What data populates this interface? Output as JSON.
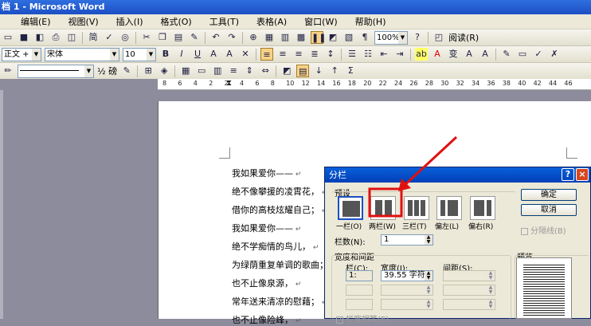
{
  "window": {
    "title": "档 1 - Microsoft Word"
  },
  "menu": [
    "编辑(E)",
    "视图(V)",
    "插入(I)",
    "格式(O)",
    "工具(T)",
    "表格(A)",
    "窗口(W)",
    "帮助(H)"
  ],
  "toolbar1": {
    "zoom": "100%",
    "reading": "阅读(R)"
  },
  "toolbar2": {
    "style": "正文 + Aria",
    "font": "宋体",
    "size": "10",
    "bold": "B",
    "italic": "I",
    "underline": "U",
    "char_a": "A"
  },
  "toolbar3": {
    "line_size": "½ 磅"
  },
  "ruler": {
    "ticks": [
      "8",
      "6",
      "4",
      "2",
      "2",
      "4",
      "6",
      "8",
      "10",
      "12",
      "14",
      "16",
      "18",
      "20",
      "22",
      "24",
      "26",
      "28",
      "30",
      "32",
      "34",
      "36",
      "38",
      "40",
      "42",
      "44",
      "46"
    ]
  },
  "document": {
    "lines": [
      "我如果爱你——",
      "绝不像攀援的凌霄花，",
      "借你的高枝炫耀自己；",
      "我如果爱你——",
      "绝不学痴情的鸟儿，",
      "为绿荫重复单调的歌曲；",
      "也不止像泉源，",
      "常年送来清凉的慰藉；",
      "也不止像险峰，"
    ]
  },
  "dialog": {
    "title": "分栏",
    "presets_label": "预设",
    "presets": [
      {
        "label": "一栏(O)",
        "cols": 1
      },
      {
        "label": "两栏(W)",
        "cols": 2
      },
      {
        "label": "三栏(T)",
        "cols": 3
      },
      {
        "label": "偏左(L)",
        "cols": 2
      },
      {
        "label": "偏右(R)",
        "cols": 2
      }
    ],
    "ok": "确定",
    "cancel": "取消",
    "line_between": "分隔线(B)",
    "num_cols_label": "栏数(N):",
    "num_cols_value": "1",
    "width_spacing_label": "宽度和间距",
    "col_label": "栏(C):",
    "width_label": "宽度(I):",
    "spacing_label": "间距(S):",
    "row1_col": "1:",
    "row1_width": "39.55 字符",
    "preview_label": "预览",
    "equal_width": "栏宽相等(E)"
  },
  "colors": {
    "annotation": "#e01010",
    "titlebar": "#1c4fc4"
  }
}
